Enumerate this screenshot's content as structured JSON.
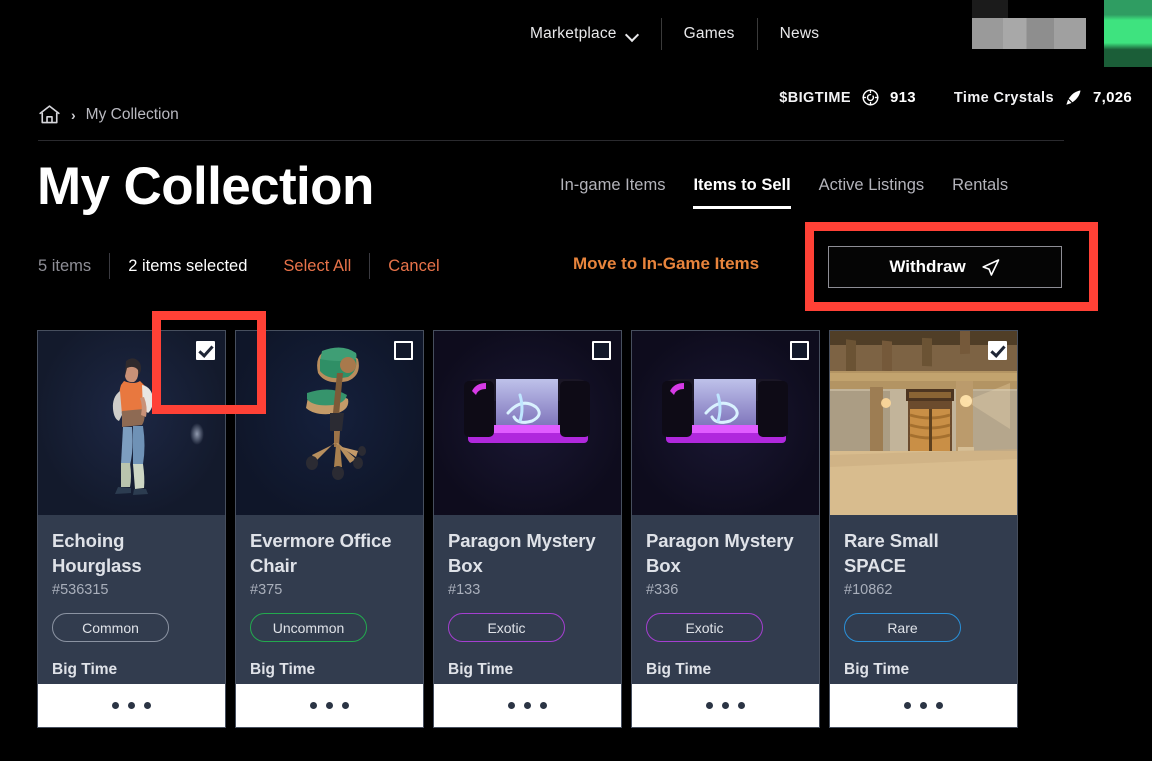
{
  "topnav": {
    "items": [
      {
        "label": "Marketplace",
        "icon": "chevron-down-icon",
        "has_dropdown": true
      },
      {
        "label": "Games",
        "has_dropdown": false
      },
      {
        "label": "News",
        "has_dropdown": false
      }
    ]
  },
  "currency": {
    "bigtime_label": "$BIGTIME",
    "bigtime_value": "913",
    "bigtime_icon": "coin-icon",
    "crystals_label": "Time Crystals",
    "crystals_value": "7,026",
    "crystals_icon": "crystal-icon"
  },
  "breadcrumb": {
    "home_icon": "home-icon",
    "separator": "›",
    "current": "My Collection"
  },
  "header": {
    "title": "My Collection"
  },
  "tabs": [
    {
      "label": "In-game Items",
      "active": false
    },
    {
      "label": "Items to Sell",
      "active": true
    },
    {
      "label": "Active Listings",
      "active": false
    },
    {
      "label": "Rentals",
      "active": false
    }
  ],
  "action_bar": {
    "item_count": "5 items",
    "selected_count": "2 items selected",
    "select_all": "Select All",
    "cancel": "Cancel",
    "move_to_ingame": "Move to In-Game Items",
    "withdraw": "Withdraw",
    "withdraw_icon": "send-icon"
  },
  "colors": {
    "accent_orange": "#e8843c",
    "link_orange": "#e8734a",
    "annotation_red": "#ff4136",
    "card_bg": "#323c4e",
    "rarity_common": "#8b93a2",
    "rarity_uncommon": "#23a94e",
    "rarity_exotic": "#a43fd0",
    "rarity_rare": "#2a90d8"
  },
  "cards": [
    {
      "title": "Echoing Hourglass",
      "id": "#536315",
      "rarity": "Common",
      "rarity_color": "#8b93a2",
      "game": "Big Time",
      "checked": true,
      "art": "character",
      "menu_icon": "more-options-icon"
    },
    {
      "title": "Evermore Office Chair",
      "id": "#375",
      "rarity": "Uncommon",
      "rarity_color": "#23a94e",
      "game": "Big Time",
      "checked": false,
      "art": "office-chair",
      "menu_icon": "more-options-icon"
    },
    {
      "title": "Paragon Mystery Box",
      "id": "#133",
      "rarity": "Exotic",
      "rarity_color": "#a43fd0",
      "game": "Big Time",
      "checked": false,
      "art": "mystery-box",
      "menu_icon": "more-options-icon"
    },
    {
      "title": "Paragon Mystery Box",
      "id": "#336",
      "rarity": "Exotic",
      "rarity_color": "#a43fd0",
      "game": "Big Time",
      "checked": false,
      "art": "mystery-box",
      "menu_icon": "more-options-icon"
    },
    {
      "title": "Rare Small SPACE",
      "id": "#10862",
      "rarity": "Rare",
      "rarity_color": "#2a90d8",
      "game": "Big Time",
      "checked": true,
      "art": "room",
      "menu_icon": "more-options-icon"
    }
  ],
  "annotations": [
    {
      "name": "withdraw-highlight",
      "target": "withdraw-button"
    },
    {
      "name": "checkbox-highlight",
      "target": "card-checkbox-0"
    }
  ]
}
